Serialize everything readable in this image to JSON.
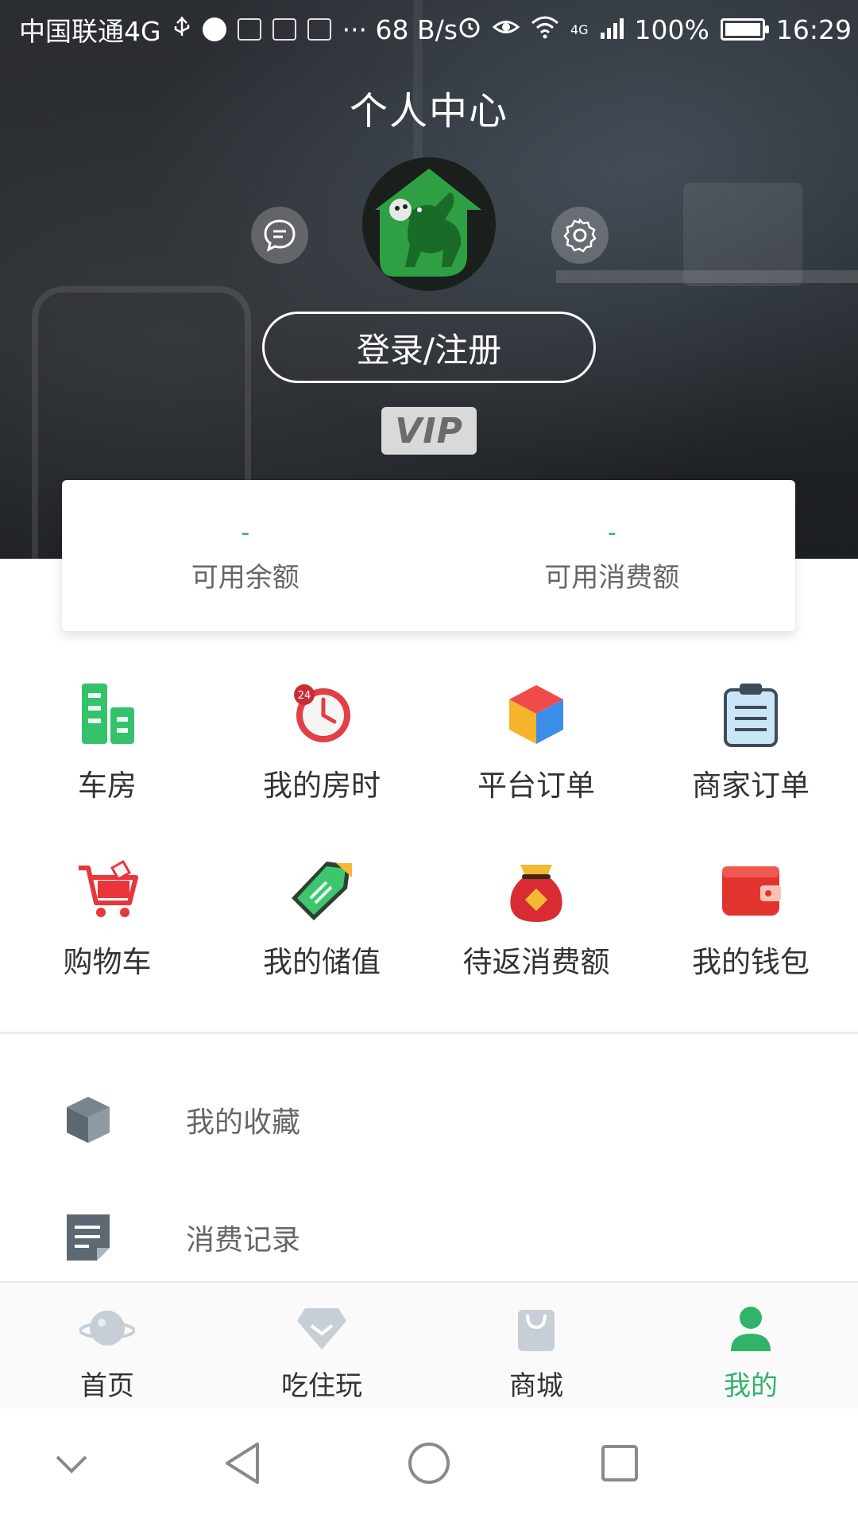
{
  "status_bar": {
    "carrier": "中国联通4G",
    "speed": "··· 68 B/s",
    "network": "4G",
    "battery": "100%",
    "time": "16:29"
  },
  "header": {
    "title": "个人中心",
    "message_icon": "chat-bubble-icon",
    "settings_icon": "gear-icon",
    "avatar": "donkey-logo",
    "login_label": "登录/注册",
    "vip_label": "VIP"
  },
  "balance": [
    {
      "value": "-",
      "label": "可用余额"
    },
    {
      "value": "-",
      "label": "可用消费额"
    }
  ],
  "grid": [
    {
      "label": "车房",
      "icon": "buildings-icon"
    },
    {
      "label": "我的房时",
      "icon": "clock-24-icon"
    },
    {
      "label": "平台订单",
      "icon": "cube-icon"
    },
    {
      "label": "商家订单",
      "icon": "clipboard-icon"
    },
    {
      "label": "购物车",
      "icon": "shopping-cart-icon"
    },
    {
      "label": "我的储值",
      "icon": "tag-icon"
    },
    {
      "label": "待返消费额",
      "icon": "money-bag-icon"
    },
    {
      "label": "我的钱包",
      "icon": "wallet-icon"
    }
  ],
  "list": [
    {
      "label": "我的收藏",
      "icon": "box-icon"
    },
    {
      "label": "消费记录",
      "icon": "document-icon"
    }
  ],
  "tabs": [
    {
      "label": "首页",
      "icon": "planet-icon",
      "active": false
    },
    {
      "label": "吃住玩",
      "icon": "diamond-icon",
      "active": false
    },
    {
      "label": "商城",
      "icon": "shopping-bag-icon",
      "active": false
    },
    {
      "label": "我的",
      "icon": "person-icon",
      "active": true
    }
  ],
  "colors": {
    "accent": "#2fb46a",
    "text": "#333333",
    "muted": "#666666"
  }
}
